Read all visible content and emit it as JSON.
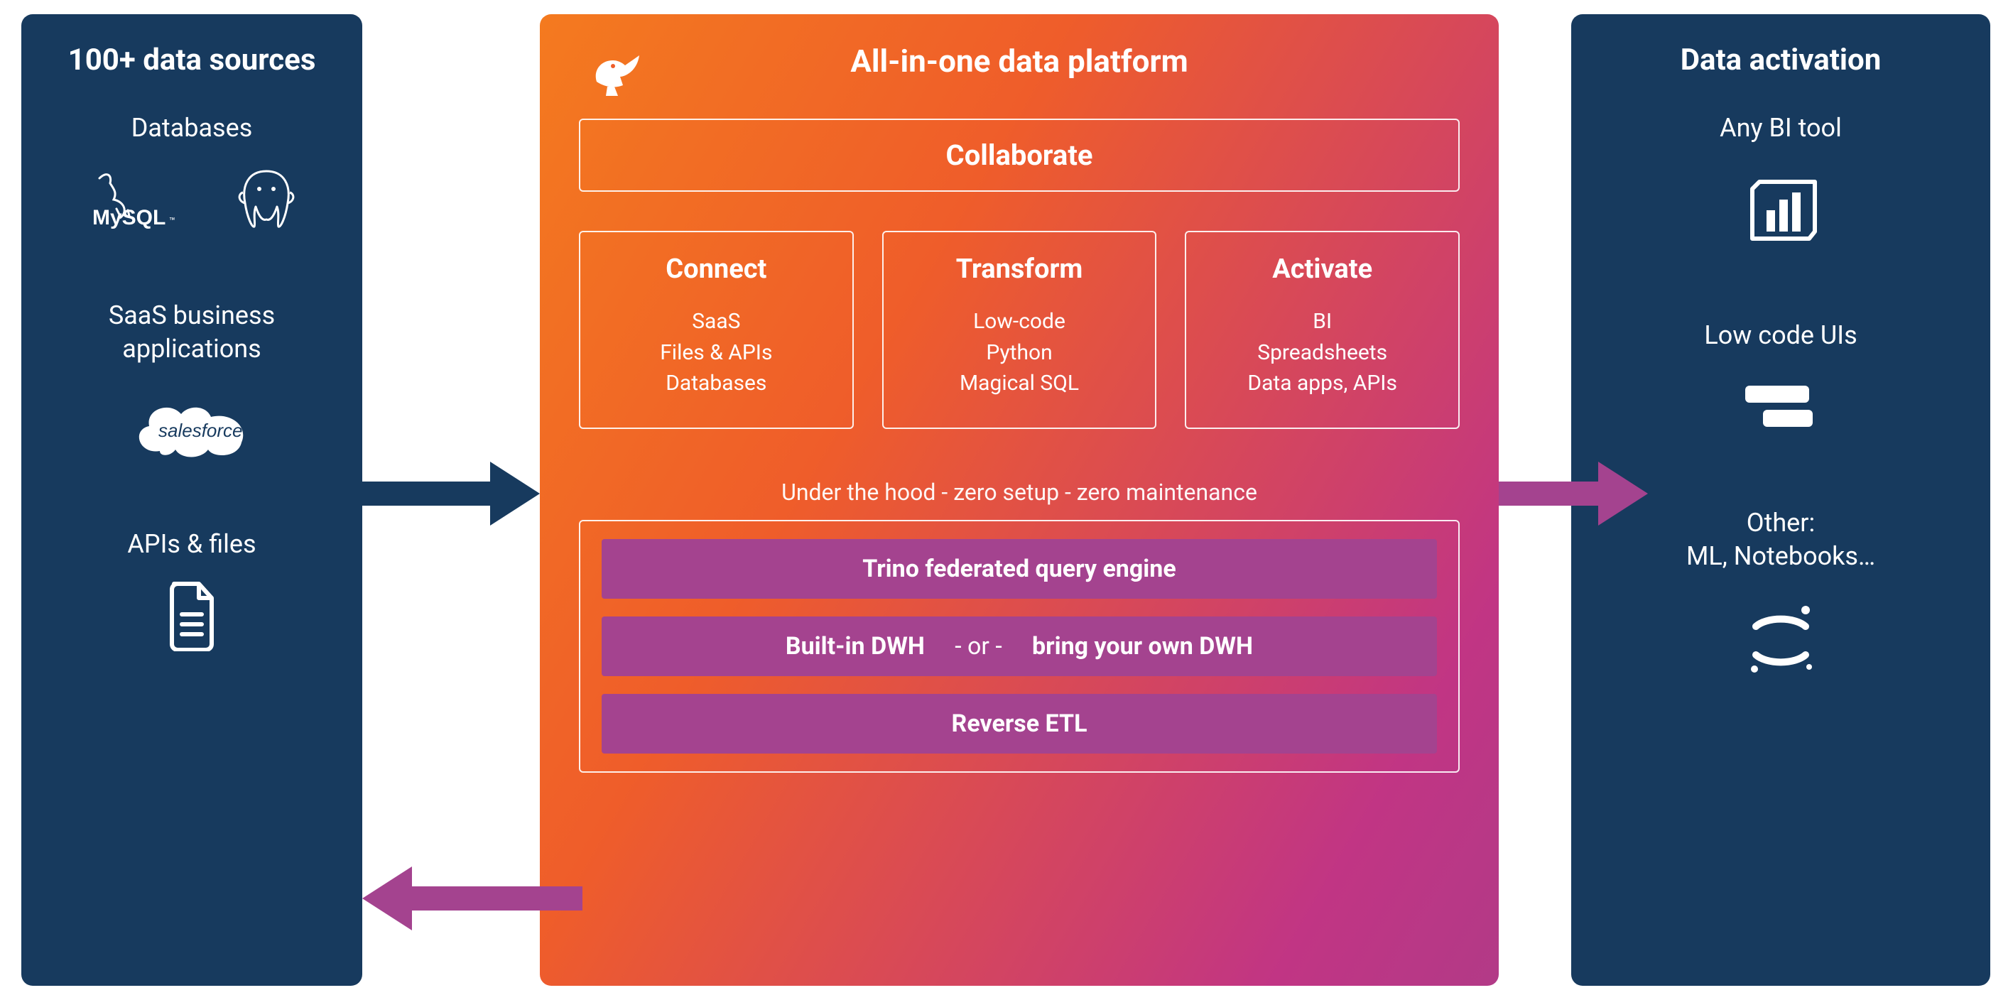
{
  "left": {
    "title": "100+ data sources",
    "groups": [
      {
        "label": "Databases",
        "icons": [
          "mysql",
          "postgres-elephant"
        ]
      },
      {
        "label": "SaaS business applications",
        "icons": [
          "salesforce"
        ]
      },
      {
        "label": "APIs & files",
        "icons": [
          "file"
        ]
      }
    ]
  },
  "center": {
    "title": "All-in-one data platform",
    "logo": "pelican",
    "collaborate": "Collaborate",
    "boxes": [
      {
        "title": "Connect",
        "lines": [
          "SaaS",
          "Files & APIs",
          "Databases"
        ]
      },
      {
        "title": "Transform",
        "lines": [
          "Low-code",
          "Python",
          "Magical SQL"
        ]
      },
      {
        "title": "Activate",
        "lines": [
          "BI",
          "Spreadsheets",
          "Data apps, APIs"
        ]
      }
    ],
    "hood_label": "Under the hood - zero setup - zero maintenance",
    "hood_bars": [
      {
        "text": "Trino federated query engine"
      },
      {
        "text_a": "Built-in DWH",
        "sep": "- or -",
        "text_b": "bring your own DWH"
      },
      {
        "text": "Reverse ETL"
      }
    ]
  },
  "right": {
    "title": "Data activation",
    "sections": [
      {
        "label": "Any BI tool",
        "icon": "powerbi"
      },
      {
        "label": "Low code UIs",
        "icon": "bars"
      },
      {
        "label": "Other:\nML, Notebooks…",
        "icon": "jupyter"
      }
    ]
  },
  "arrows": {
    "in_color": "#173a5e",
    "out_color": "#a4438f",
    "back_color": "#a4438f"
  }
}
